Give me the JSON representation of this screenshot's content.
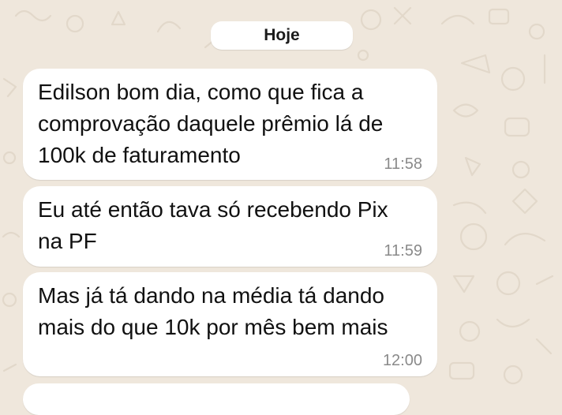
{
  "chat": {
    "date_label": "Hoje",
    "messages": [
      {
        "text": "Edilson bom dia, como que fica a\ncomprovação daquele prêmio lá de\n100k de faturamento",
        "time": "11:58"
      },
      {
        "text": "Eu até então tava só recebendo Pix\nna PF",
        "time": "11:59"
      },
      {
        "text": "Mas já tá dando na média tá dando\nmais do que 10k por mês bem mais",
        "time": "12:00"
      }
    ]
  },
  "colors": {
    "background": "#EFE7DC",
    "bubble": "#FFFFFF",
    "timestamp": "#8A8A8A",
    "text": "#111111"
  }
}
